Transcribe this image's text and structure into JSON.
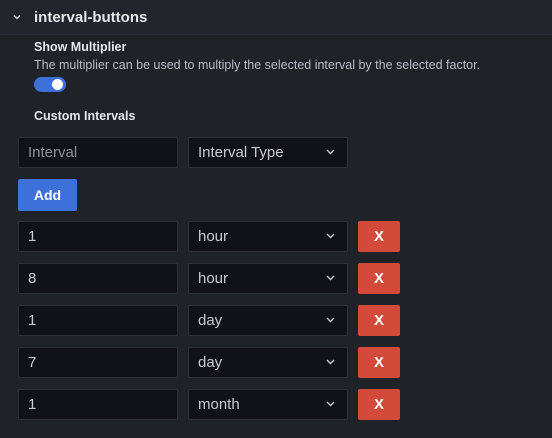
{
  "section": {
    "title": "interval-buttons"
  },
  "show_multiplier": {
    "label": "Show Multiplier",
    "description": "The multiplier can be used to multiply the selected interval by the selected factor.",
    "enabled": true
  },
  "custom_intervals": {
    "label": "Custom Intervals",
    "new_interval": {
      "placeholder": "Interval",
      "type_placeholder": "Interval Type"
    },
    "add_label": "Add",
    "delete_label": "X",
    "items": [
      {
        "value": "1",
        "type": "hour"
      },
      {
        "value": "8",
        "type": "hour"
      },
      {
        "value": "1",
        "type": "day"
      },
      {
        "value": "7",
        "type": "day"
      },
      {
        "value": "1",
        "type": "month"
      }
    ]
  },
  "colors": {
    "accent": "#3d71d9",
    "danger": "#d44a3a",
    "background": "#181b1f"
  }
}
